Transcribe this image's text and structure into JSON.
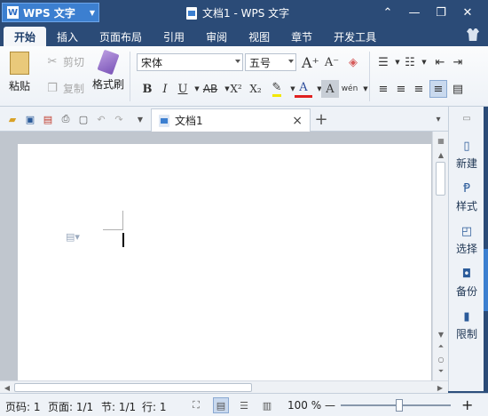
{
  "app": {
    "button_label": "WPS 文字",
    "logo_letter": "W",
    "window_title": "文档1 - WPS 文字"
  },
  "window_controls": {
    "menu": "⌃",
    "minimize": "—",
    "restore": "❐",
    "close": "✕"
  },
  "menu_tabs": [
    {
      "label": "开始",
      "active": true
    },
    {
      "label": "插入"
    },
    {
      "label": "页面布局"
    },
    {
      "label": "引用"
    },
    {
      "label": "审阅"
    },
    {
      "label": "视图"
    },
    {
      "label": "章节"
    },
    {
      "label": "开发工具"
    }
  ],
  "ribbon": {
    "paste": "粘贴",
    "cut": "剪切",
    "copy": "复制",
    "format_painter": "格式刷",
    "font_name": "宋体",
    "font_size": "五号",
    "bold": "B",
    "italic": "I",
    "underline": "U",
    "strikethrough": "AB",
    "superscript": "X²",
    "subscript": "X₂",
    "grow_font": "A⁺",
    "shrink_font": "A⁻",
    "font_color": "A",
    "char_shading": "A",
    "phonetic": "wén"
  },
  "document_tab": {
    "title": "文档1",
    "close": "×",
    "new_tab": "+"
  },
  "task_panel": [
    {
      "label": "新建",
      "icon": "new-doc-icon"
    },
    {
      "label": "样式",
      "icon": "style-icon"
    },
    {
      "label": "选择",
      "icon": "select-icon"
    },
    {
      "label": "备份",
      "icon": "backup-icon"
    },
    {
      "label": "限制",
      "icon": "restrict-icon"
    }
  ],
  "status": {
    "page": "页码: 1",
    "pages": "页面: 1/1",
    "section": "节: 1/1",
    "line": "行: 1",
    "zoom": "100 %",
    "zoom_minus": "—",
    "zoom_plus": "+"
  },
  "colors": {
    "title_bg": "#2b4b77",
    "accent": "#3c7fd0",
    "ribbon_bg": "#eef2f7",
    "font_color_bar": "#e02020",
    "highlight_bar": "#f2e800"
  }
}
